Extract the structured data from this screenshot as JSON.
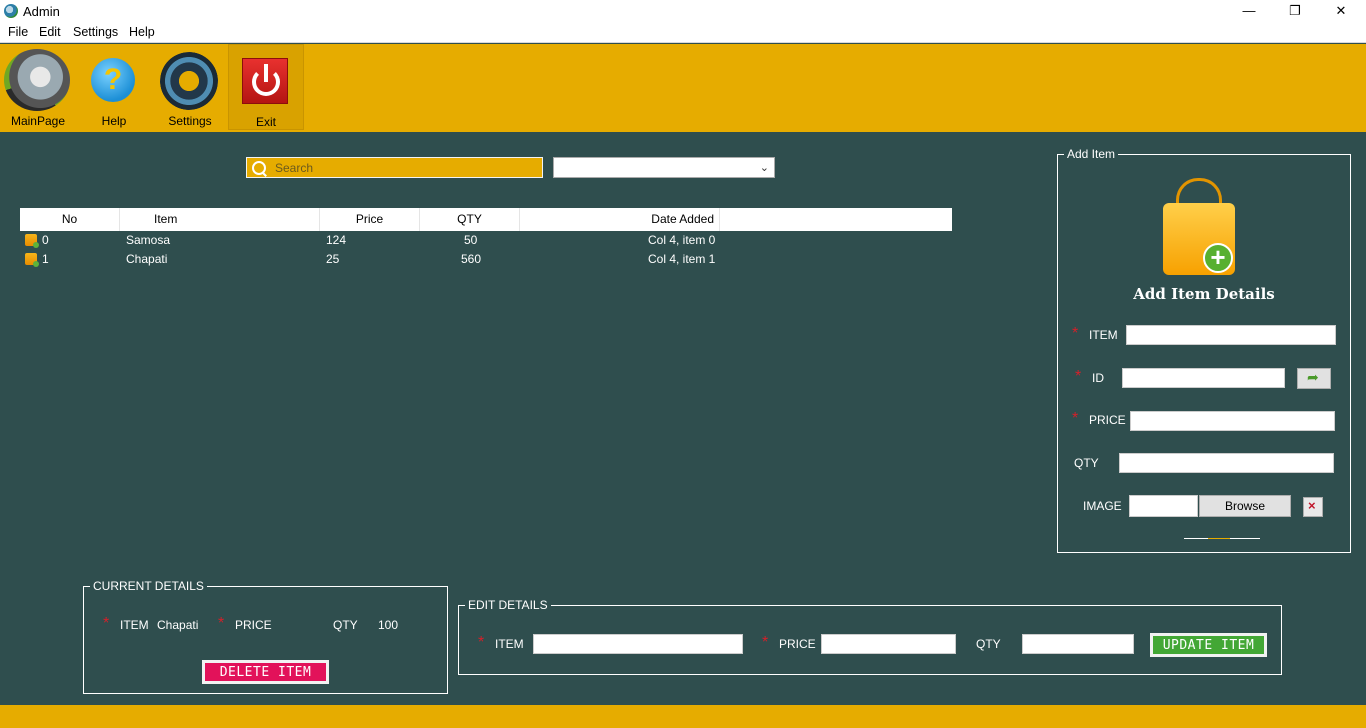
{
  "window": {
    "title": "Admin",
    "controls": {
      "minimize": "—",
      "maximize": "❐",
      "close": "✕"
    }
  },
  "menu": [
    "File",
    "Edit",
    "Settings",
    "Help"
  ],
  "toolbar": {
    "mainpage": "MainPage",
    "help": "Help",
    "settings": "Settings",
    "exit": "Exit"
  },
  "search": {
    "placeholder": "Search",
    "value": ""
  },
  "filter": {
    "selected": ""
  },
  "list": {
    "columns": [
      "No",
      "Item",
      "Price",
      "QTY",
      "Date Added"
    ],
    "rows": [
      {
        "no": "0",
        "item": "Samosa",
        "price": "124",
        "qty": "50",
        "date": "Col 4, item 0"
      },
      {
        "no": "1",
        "item": "Chapati",
        "price": "25",
        "qty": "560",
        "date": "Col 4, item 1"
      }
    ]
  },
  "add_item": {
    "legend": "Add Item",
    "title": "Add Item Details",
    "labels": {
      "item": "ITEM",
      "id": "ID",
      "price": "PRICE",
      "qty": "QTY",
      "image": "IMAGE"
    },
    "required_mark": "*",
    "browse": "Browse"
  },
  "current": {
    "legend": "CURRENT DETAILS",
    "item_label": "ITEM",
    "item_value": "Chapati",
    "price_label": "PRICE",
    "price_value": "",
    "qty_label": "QTY",
    "qty_value": "100",
    "delete": "DELETE ITEM"
  },
  "edit": {
    "legend": "EDIT DETAILS",
    "item_label": "ITEM",
    "price_label": "PRICE",
    "qty_label": "QTY",
    "update": "UPDATE ITEM"
  },
  "colors": {
    "accent": "#e6ac00",
    "background": "#2f4e4e",
    "delete": "#e2125a",
    "update": "#43a735",
    "required": "#d4202a"
  }
}
